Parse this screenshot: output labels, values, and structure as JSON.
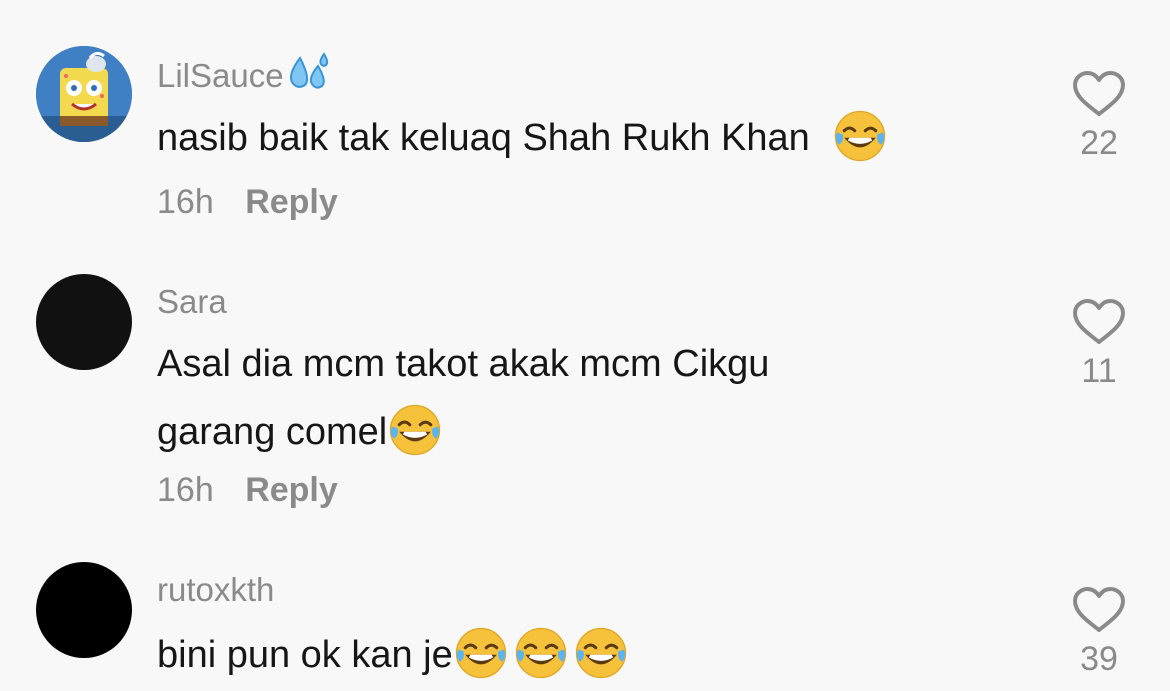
{
  "comments": [
    {
      "username": "LilSauce",
      "username_emoji": "sweat-droplets-icon",
      "text": "nasib baik tak keluaq Shah Rukh Khan",
      "text_emojis": 1,
      "time": "16h",
      "reply_label": "Reply",
      "likes": "22",
      "avatar": "spongebob-avatar"
    },
    {
      "username": "Sara",
      "text_line1": "Asal dia mcm takot akak mcm Cikgu",
      "text_line2": "garang comel",
      "text_emojis": 1,
      "time": "16h",
      "reply_label": "Reply",
      "likes": "11",
      "avatar": "dark-avatar"
    },
    {
      "username": "rutoxkth",
      "text": "bini pun ok kan je",
      "text_emojis": 3,
      "likes": "39",
      "avatar": "dark-avatar"
    }
  ],
  "colors": {
    "background": "#f8f8f8",
    "text": "#161616",
    "muted": "#8a8a8a",
    "emoji_face": "#f7c23b"
  }
}
